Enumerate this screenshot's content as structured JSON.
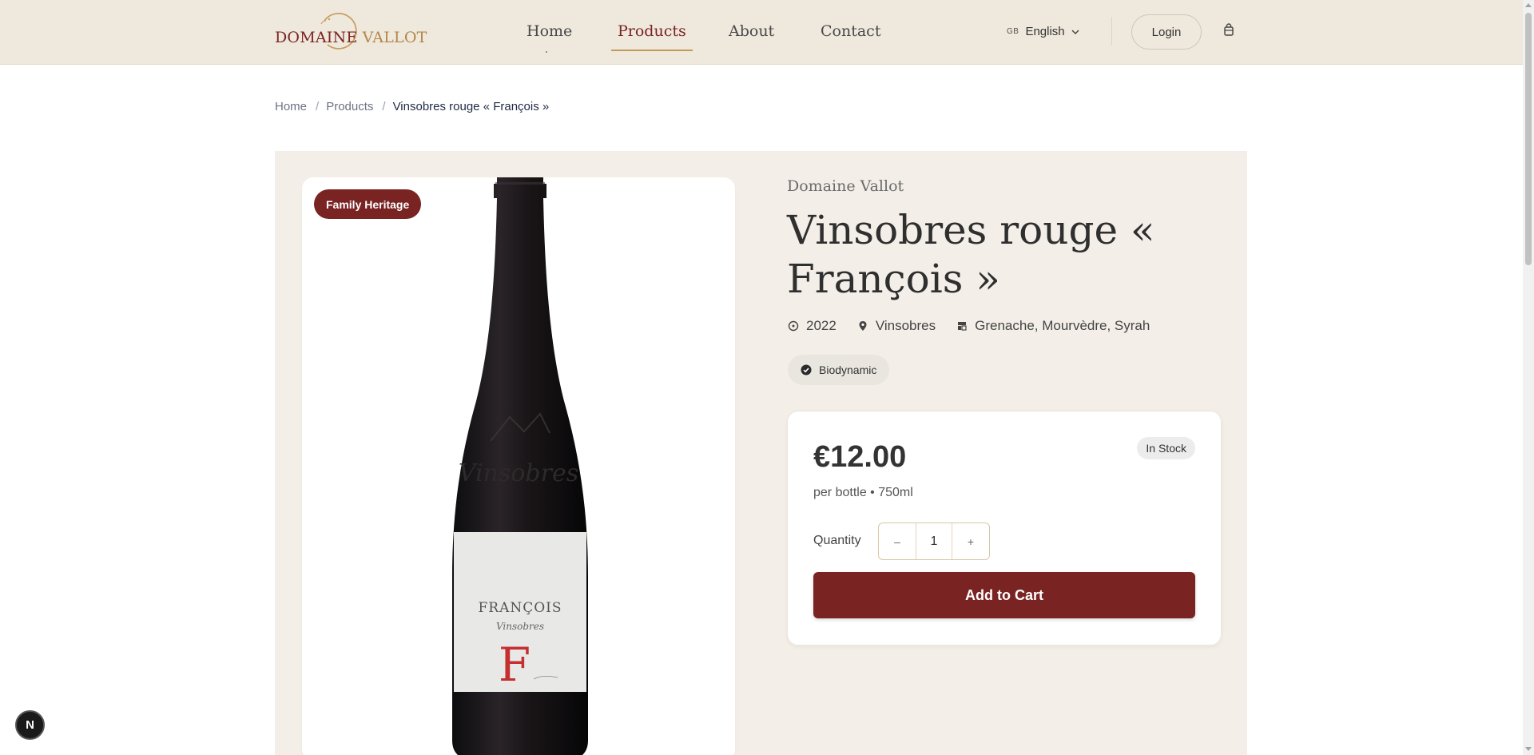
{
  "header": {
    "logo_text_a": "DOMAINE",
    "logo_text_b": "VALLOT",
    "nav": [
      {
        "label": "Home"
      },
      {
        "label": "Products"
      },
      {
        "label": "About"
      },
      {
        "label": "Contact"
      }
    ],
    "lang_flag": "GB",
    "lang_label": "English",
    "login_label": "Login"
  },
  "breadcrumb": {
    "items": [
      "Home",
      "Products",
      "Vinsobres rouge « François »"
    ],
    "separator": "/"
  },
  "product": {
    "badge": "Family Heritage",
    "producer": "Domaine Vallot",
    "title": "Vinsobres rouge « François »",
    "vintage": "2022",
    "region": "Vinsobres",
    "grapes": "Grenache, Mourvèdre, Syrah",
    "certification": "Biodynamic",
    "price": "€12.00",
    "stock": "In Stock",
    "per_unit": "per bottle • 750ml",
    "quantity_label": "Quantity",
    "quantity_value": "1",
    "minus": "–",
    "plus": "+",
    "add_to_cart": "Add to Cart",
    "label_name": "FRANÇOIS",
    "label_sub": "Vinsobres",
    "label_letter": "F",
    "embossed": "Vinsobres"
  },
  "dev_badge": "N",
  "colors": {
    "brand": "#7a2323",
    "gold": "#c49a5a",
    "header_bg": "#efe8dc",
    "panel_bg": "#f3efe8"
  }
}
